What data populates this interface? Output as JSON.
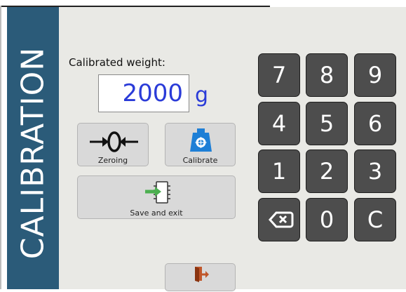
{
  "sidebar": {
    "title": "CALIBRATION"
  },
  "weight": {
    "label": "Calibrated weight:",
    "value": "2000",
    "unit": "g"
  },
  "buttons": {
    "zeroing": {
      "glyph": "→ 0 ←",
      "label": "Zeroing"
    },
    "calibrate": {
      "label": "Calibrate"
    },
    "save": {
      "label": "Save and exit"
    }
  },
  "keypad": {
    "keys": [
      "7",
      "8",
      "9",
      "4",
      "5",
      "6",
      "1",
      "2",
      "3",
      "backspace",
      "0",
      "C"
    ]
  },
  "colors": {
    "sidebar": "#2b5b79",
    "value_text": "#2a3bd8",
    "key_bg": "#4d4d4d",
    "calibrate_icon": "#1e7fd6",
    "save_icon": "#4caf50",
    "exit_icon": "#c0562a"
  }
}
